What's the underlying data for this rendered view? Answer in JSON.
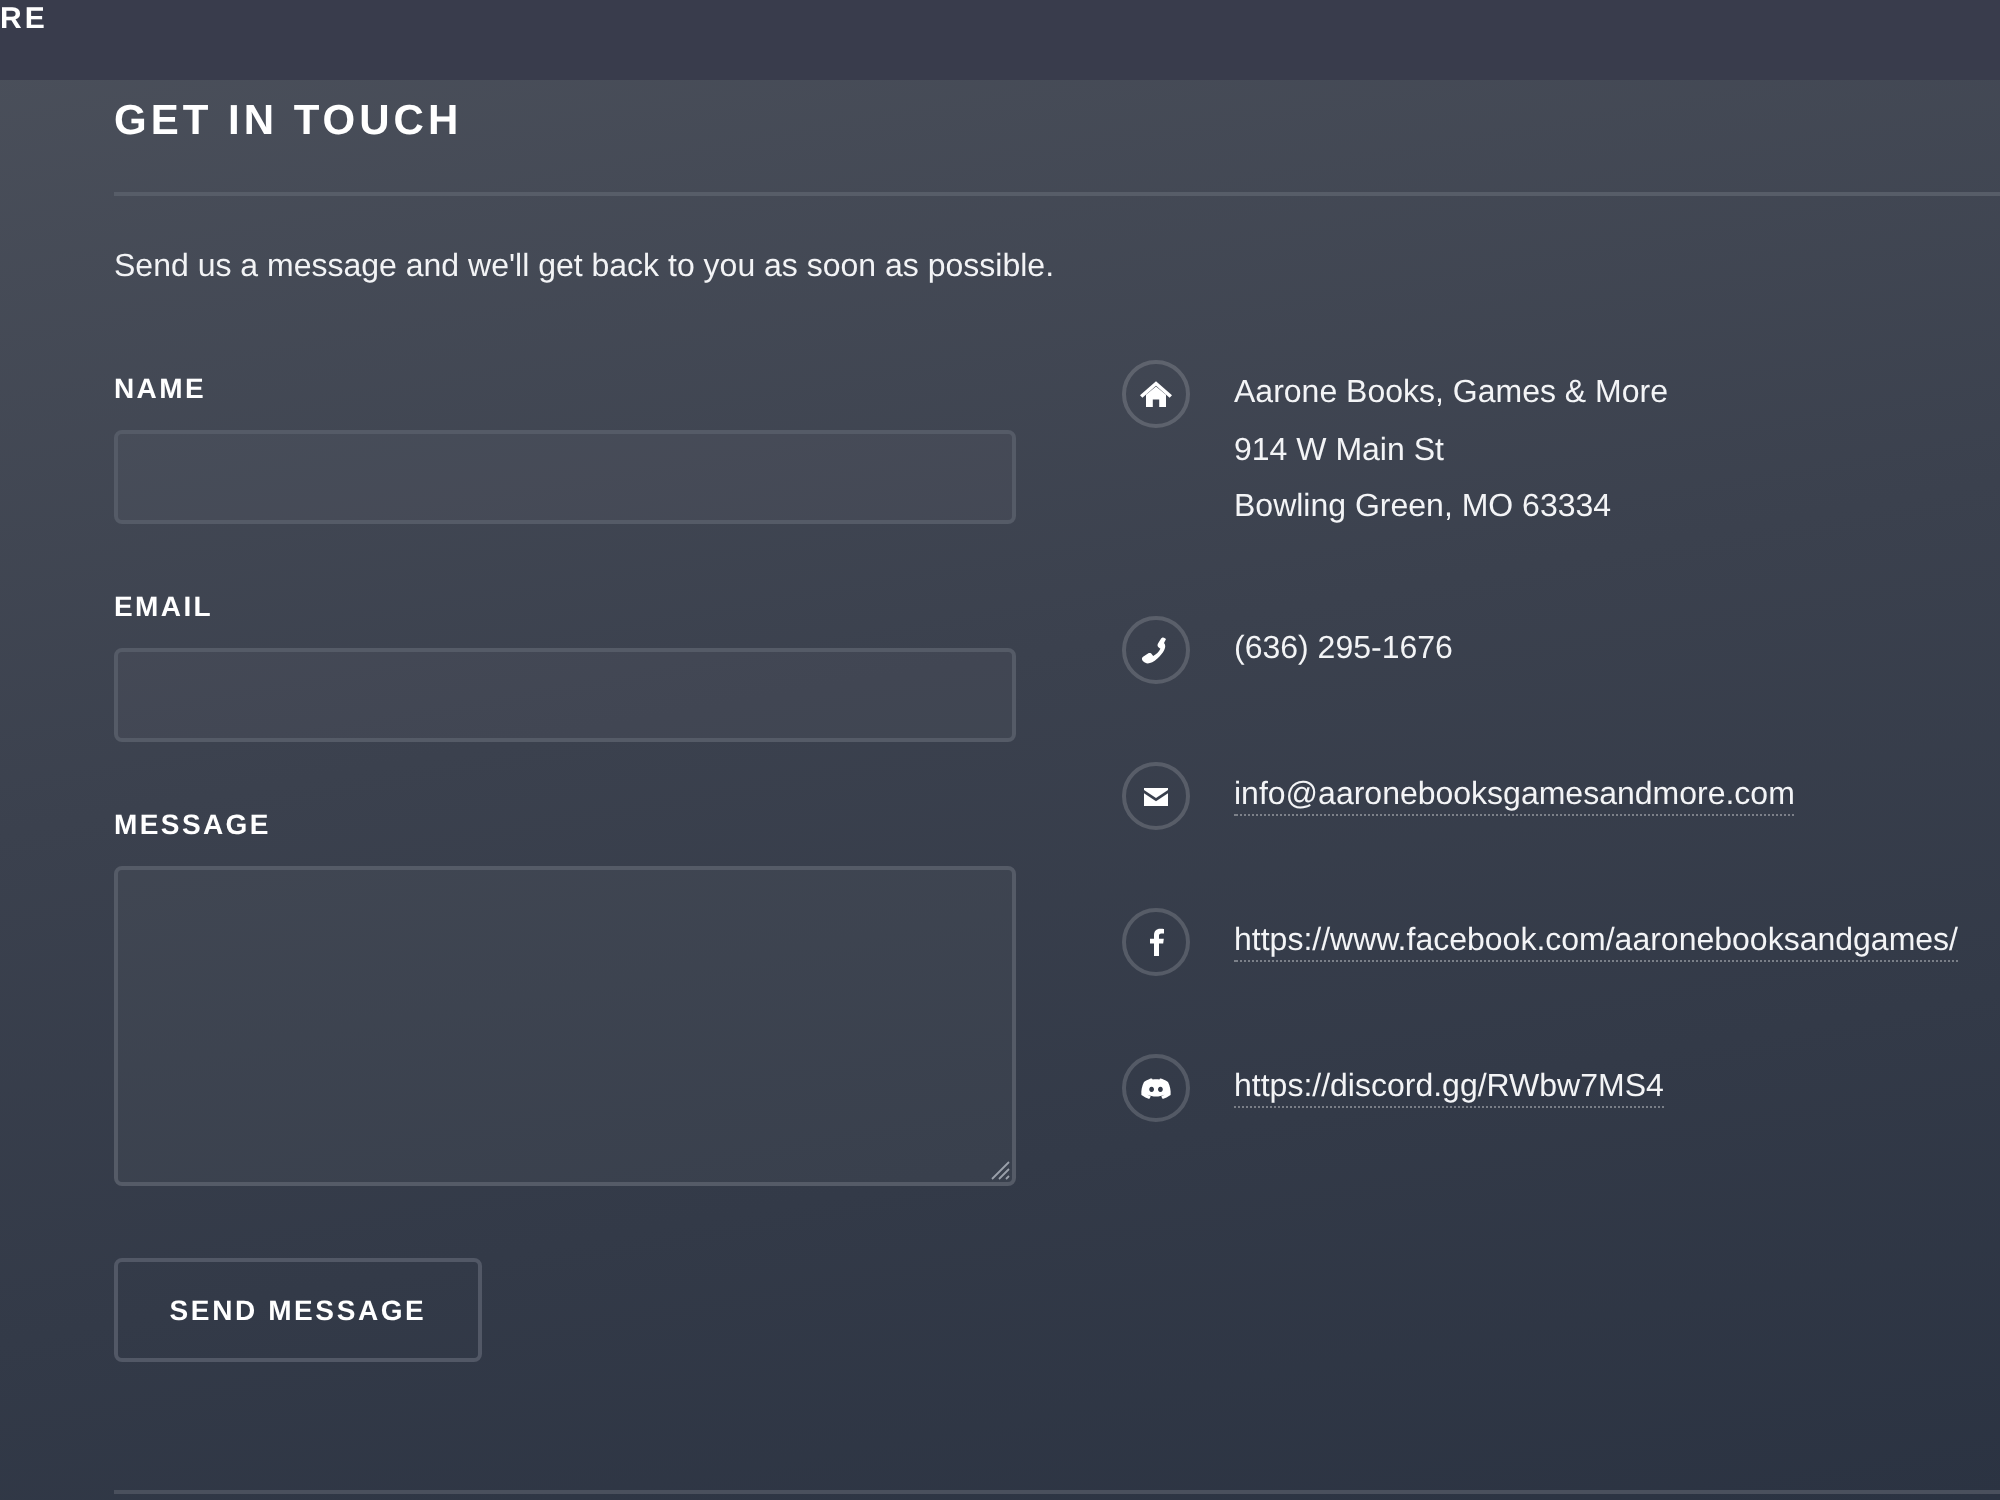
{
  "header": {
    "text": "RE"
  },
  "section": {
    "title": "GET IN TOUCH",
    "intro": "Send us a message and we'll get back to you as soon as possible."
  },
  "form": {
    "fields": [
      {
        "label": "NAME",
        "kind": "input"
      },
      {
        "label": "EMAIL",
        "kind": "input"
      },
      {
        "label": "MESSAGE",
        "kind": "textarea"
      }
    ],
    "submit": "SEND MESSAGE"
  },
  "contact": [
    {
      "kind": "address",
      "lines": [
        "Aarone Books, Games & More",
        "914 W Main St",
        "Bowling Green, MO 63334"
      ]
    },
    {
      "kind": "phone",
      "lines": [
        "(636) 295-1676"
      ]
    },
    {
      "kind": "email",
      "lines": [
        "info@aaronebooksgamesandmore.com"
      ]
    },
    {
      "kind": "facebook",
      "lines": [
        "https://www.facebook.com/aaronebooksandgames/"
      ]
    },
    {
      "kind": "discord",
      "lines": [
        "https://discord.gg/RWbw7MS4"
      ]
    }
  ]
}
